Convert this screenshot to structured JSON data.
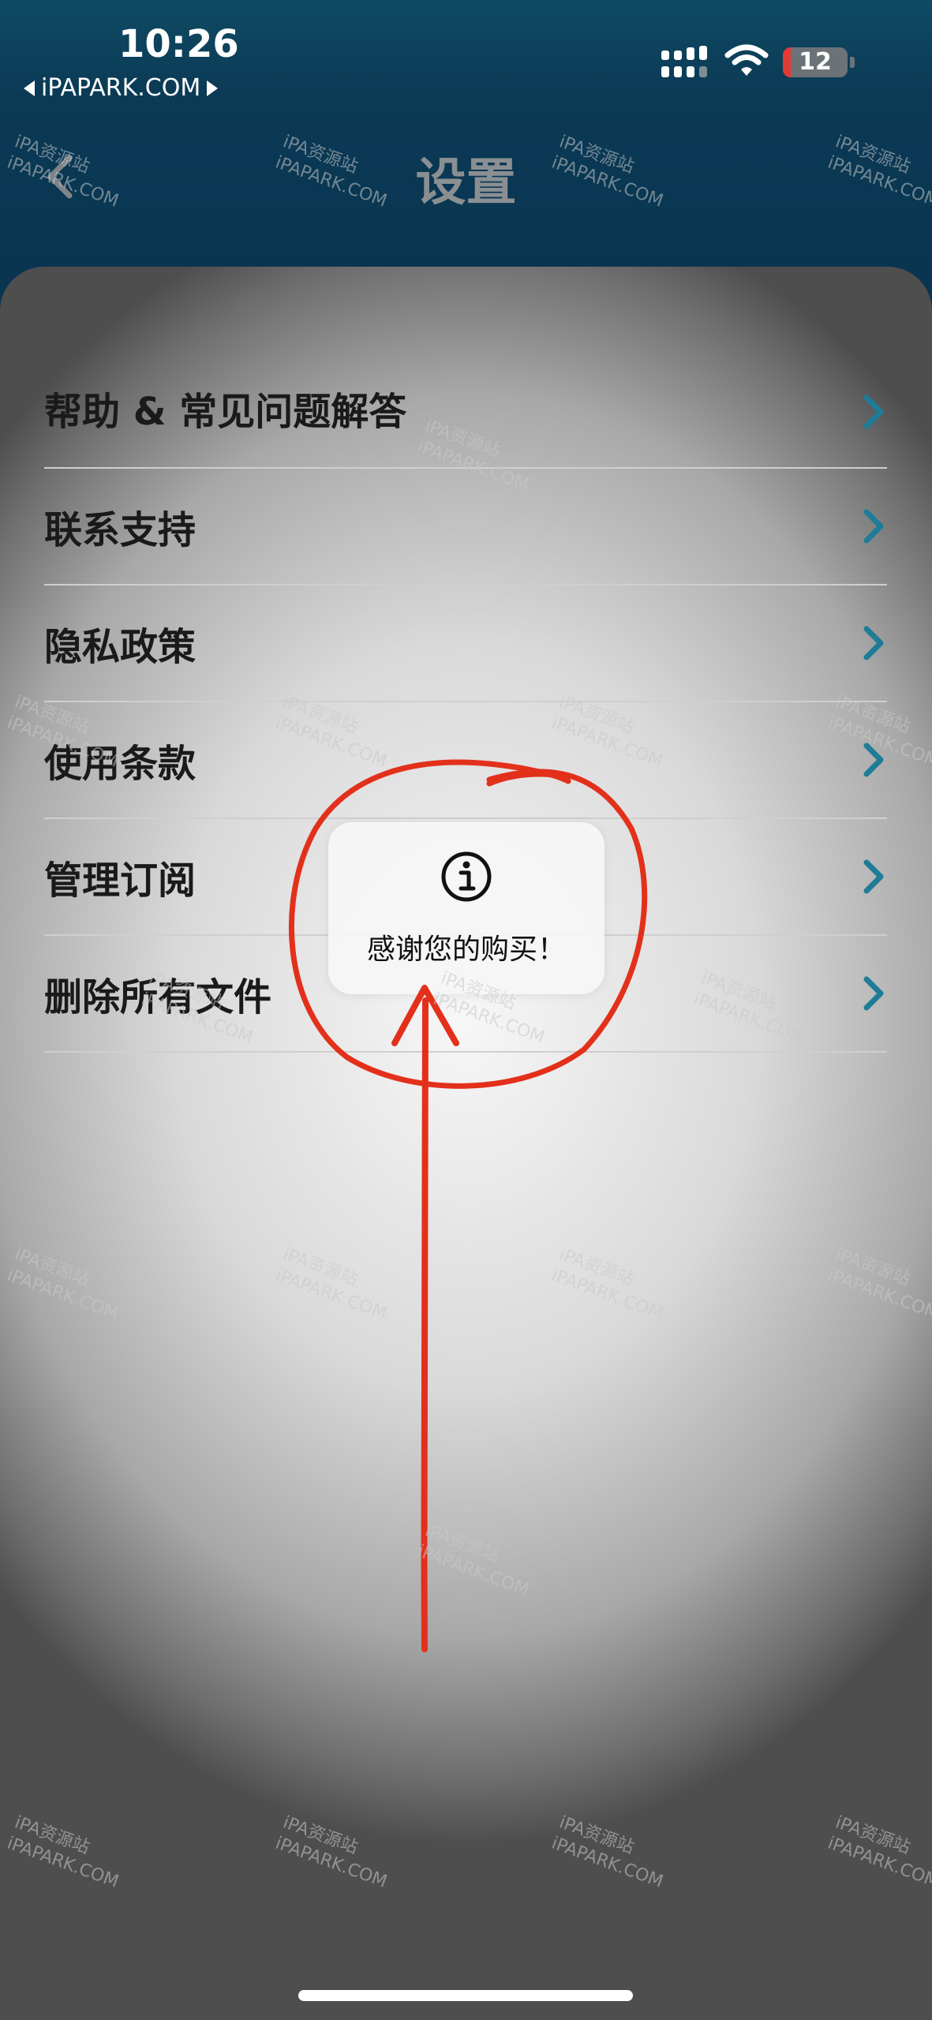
{
  "status_bar": {
    "time": "10:26",
    "back_app": "iPAPARK.COM",
    "battery_level": "12",
    "battery_fraction": 0.12,
    "battery_color": "#e53935"
  },
  "header": {
    "title": "设置",
    "back_icon": "chevron-left-icon"
  },
  "menu": {
    "items": [
      {
        "label": "帮助 & 常见问题解答"
      },
      {
        "label": "联系支持"
      },
      {
        "label": "隐私政策"
      },
      {
        "label": "使用条款"
      },
      {
        "label": "管理订阅"
      },
      {
        "label": "删除所有文件"
      }
    ],
    "chevron_color": "#1f7c97"
  },
  "toast": {
    "icon": "info-icon",
    "message": "感谢您的购买！"
  },
  "watermark": {
    "line1": "iPA资源站",
    "line2": "iPAPARK.COM"
  },
  "annotation_color": "#e3301b"
}
